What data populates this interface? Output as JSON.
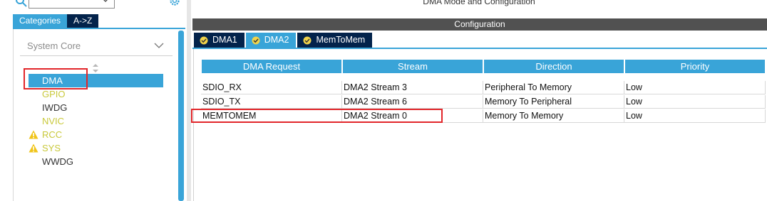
{
  "left": {
    "tabs": {
      "categories": "Categories",
      "atoz": "A->Z"
    },
    "section": "System Core",
    "items": [
      {
        "label": "DMA",
        "state": "selected"
      },
      {
        "label": "GPIO",
        "state": "configured"
      },
      {
        "label": "IWDG",
        "state": "normal"
      },
      {
        "label": "NVIC",
        "state": "configured"
      },
      {
        "label": "RCC",
        "state": "warning"
      },
      {
        "label": "SYS",
        "state": "warning"
      },
      {
        "label": "WWDG",
        "state": "normal"
      }
    ]
  },
  "right": {
    "title": "DMA Mode and Configuration",
    "config_label": "Configuration",
    "tabs": [
      "DMA1",
      "DMA2",
      "MemToMem"
    ],
    "active_tab": "DMA2",
    "columns": [
      "DMA Request",
      "Stream",
      "Direction",
      "Priority"
    ],
    "rows": [
      [
        "SDIO_RX",
        "DMA2 Stream 3",
        "Peripheral To Memory",
        "Low"
      ],
      [
        "SDIO_TX",
        "DMA2 Stream 6",
        "Memory To Peripheral",
        "Low"
      ],
      [
        "MEMTOMEM",
        "DMA2 Stream 0",
        "Memory To Memory",
        "Low"
      ]
    ]
  },
  "colors": {
    "accent": "#39a4d8",
    "navy": "#03234b",
    "highlight": "#e2262a",
    "configured": "#c9c93a",
    "warning": "#f0c419"
  },
  "icons": [
    "search-icon",
    "gear-icon",
    "chevron-down-icon",
    "warning-icon",
    "check-circle-icon",
    "sort-arrows-icon"
  ]
}
